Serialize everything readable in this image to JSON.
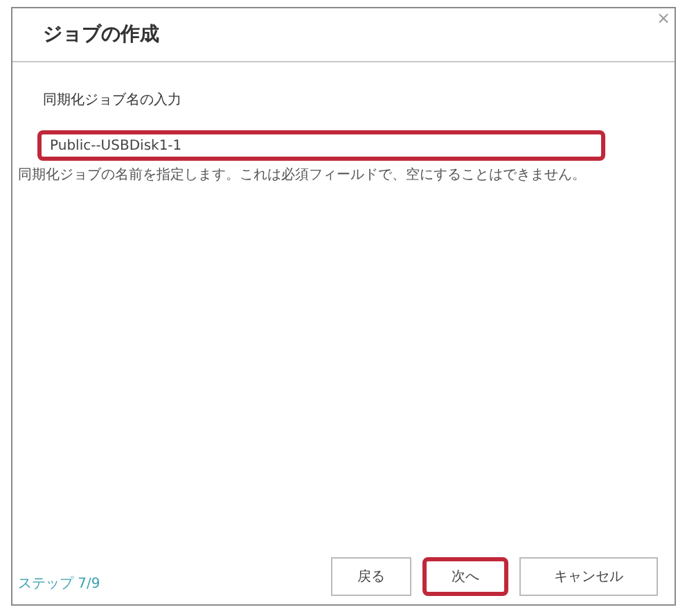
{
  "dialog": {
    "title": "ジョブの作成",
    "close": "×"
  },
  "section_label": "同期化ジョブ名の入力",
  "name_field": {
    "value": "Public--USBDisk1-1",
    "highlighted": true
  },
  "help_text": "同期化ジョブの名前を指定します。これは必須フィールドで、空にすることはできません。",
  "step": "ステップ 7/9",
  "buttons": [
    {
      "label": "戻る",
      "highlighted": false
    },
    {
      "label": "次へ",
      "highlighted": true
    },
    {
      "label": "キャンセル",
      "highlighted": false
    }
  ]
}
